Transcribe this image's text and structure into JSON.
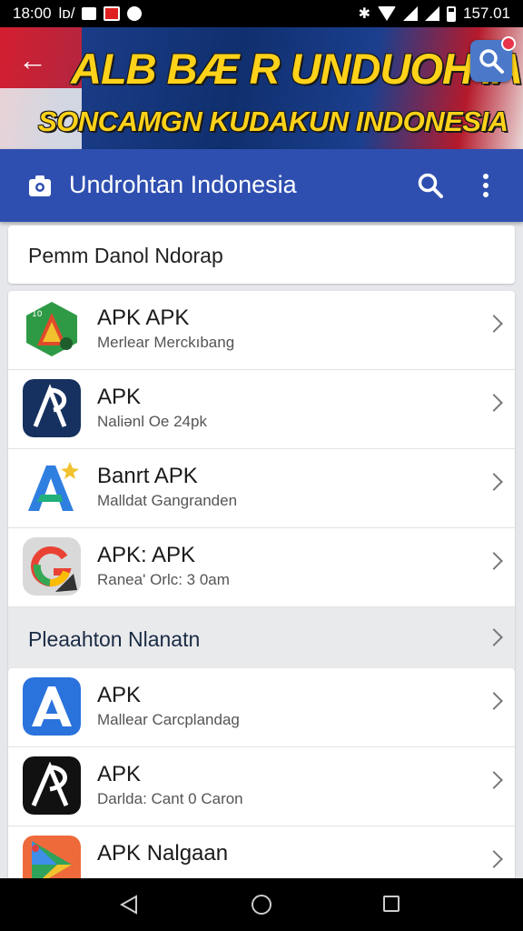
{
  "status_bar": {
    "time": "18:00",
    "carrier_text": "lᴅ/",
    "battery_time": "157.01"
  },
  "banner": {
    "line1": "ALB BÆ R UNDUOH'IA",
    "line2": "SONCAMGN KUDAKUN INDONESIA"
  },
  "app_bar": {
    "title": "Undrohtan Indonesia"
  },
  "section": {
    "title": "Pemm Danol Ndorap"
  },
  "list1": [
    {
      "name": "APK APK",
      "sub": "Merlear Merckıbang",
      "icon": "green-hex-a-icon"
    },
    {
      "name": "APK",
      "sub": "Naliənl Oe 24pk",
      "icon": "navy-ap-icon"
    },
    {
      "name": "Banrt APK",
      "sub": "Malldat Gangranden",
      "icon": "blue-a-star-icon"
    },
    {
      "name": "APK: APK",
      "sub": "Ranea' Orlc: 3 0am",
      "icon": "google-g-icon"
    }
  ],
  "subsection": {
    "title": "Pleaahton Nlanatn"
  },
  "list2": [
    {
      "name": "APK",
      "sub": "Mallear Carcplandag",
      "icon": "blue-a-icon"
    },
    {
      "name": "APK",
      "sub": "Darlda: Cant 0 Caron",
      "icon": "black-ap-icon"
    },
    {
      "name": "APK Nalgaan",
      "sub": "",
      "icon": "play-store-icon"
    }
  ],
  "colors": {
    "app_bar": "#2f4fb0",
    "banner_text": "#ffd21a"
  }
}
